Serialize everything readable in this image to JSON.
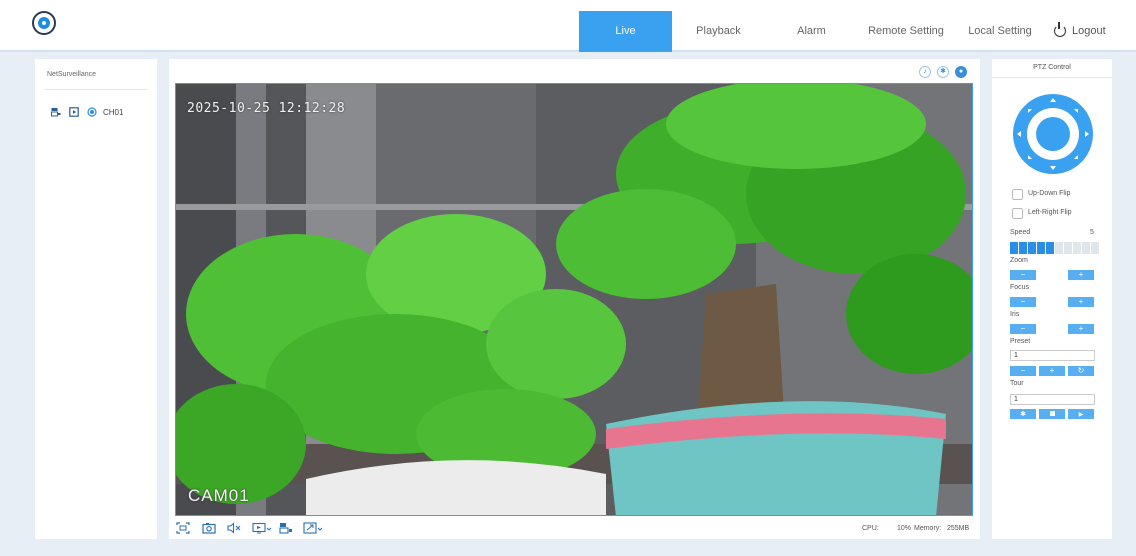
{
  "header": {
    "nav": [
      {
        "label": "Live",
        "active": true
      },
      {
        "label": "Playback",
        "active": false
      },
      {
        "label": "Alarm",
        "active": false
      },
      {
        "label": "Remote Setting",
        "active": false
      },
      {
        "label": "Local Setting",
        "active": false
      }
    ],
    "logout_label": "Logout"
  },
  "sidebar": {
    "title": "NetSurveillance",
    "channel_label": "CH01"
  },
  "video": {
    "osd_time": "2025-10-25 12:12:28",
    "osd_name": "CAM01"
  },
  "status": {
    "cpu_label": "CPU:",
    "cpu_value": "10%",
    "memory_label": "Memory:",
    "memory_value": "255MB"
  },
  "ptz": {
    "title": "PTZ Control",
    "updown_flip": "Up-Down Flip",
    "leftright_flip": "Left-Right Flip",
    "speed_label": "Speed",
    "speed_value": "5",
    "speed_level": 5,
    "speed_max": 10,
    "zoom_label": "Zoom",
    "focus_label": "Focus",
    "iris_label": "Iris",
    "preset_label": "Preset",
    "preset_value": "1",
    "tour_label": "Tour",
    "tour_value": "1",
    "minus": "−",
    "plus": "+"
  },
  "colors": {
    "accent": "#3aa0f0",
    "button": "#57aef0"
  }
}
